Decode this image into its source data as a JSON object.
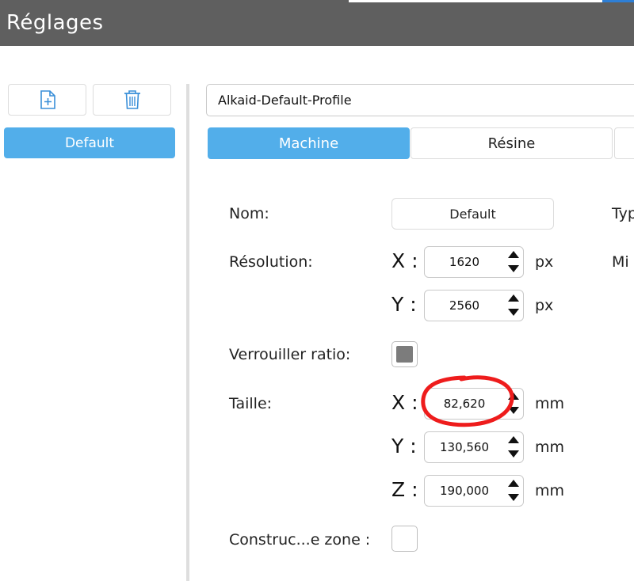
{
  "window": {
    "title": "Réglages"
  },
  "left": {
    "add_icon": "file-plus-icon",
    "delete_icon": "trash-icon",
    "profiles": [
      "Default"
    ]
  },
  "right": {
    "profile_name": "Alkaid-Default-Profile",
    "tabs": [
      "Machine",
      "Résine"
    ],
    "form": {
      "nom_label": "Nom:",
      "nom_value": "Default",
      "type_label_partial": "Typ",
      "resolution_label": "Résolution:",
      "min_label_partial": "Mi",
      "res_x_axis": "X :",
      "res_x": "1620",
      "res_y_axis": "Y :",
      "res_y": "2560",
      "px_unit": "px",
      "lock_label": "Verrouiller ratio:",
      "lock_checked": true,
      "size_label": "Taille:",
      "size_x_axis": "X :",
      "size_x": "82,620",
      "size_y_axis": "Y :",
      "size_y": "130,560",
      "size_z_axis": "Z :",
      "size_z": "190,000",
      "mm_unit": "mm",
      "build_zone_label": "Construc...e zone :",
      "build_zone_checked": false
    }
  },
  "colors": {
    "titlebar": "#5f5f5f",
    "accent": "#52aeea",
    "annotation": "#ee1c1c"
  }
}
